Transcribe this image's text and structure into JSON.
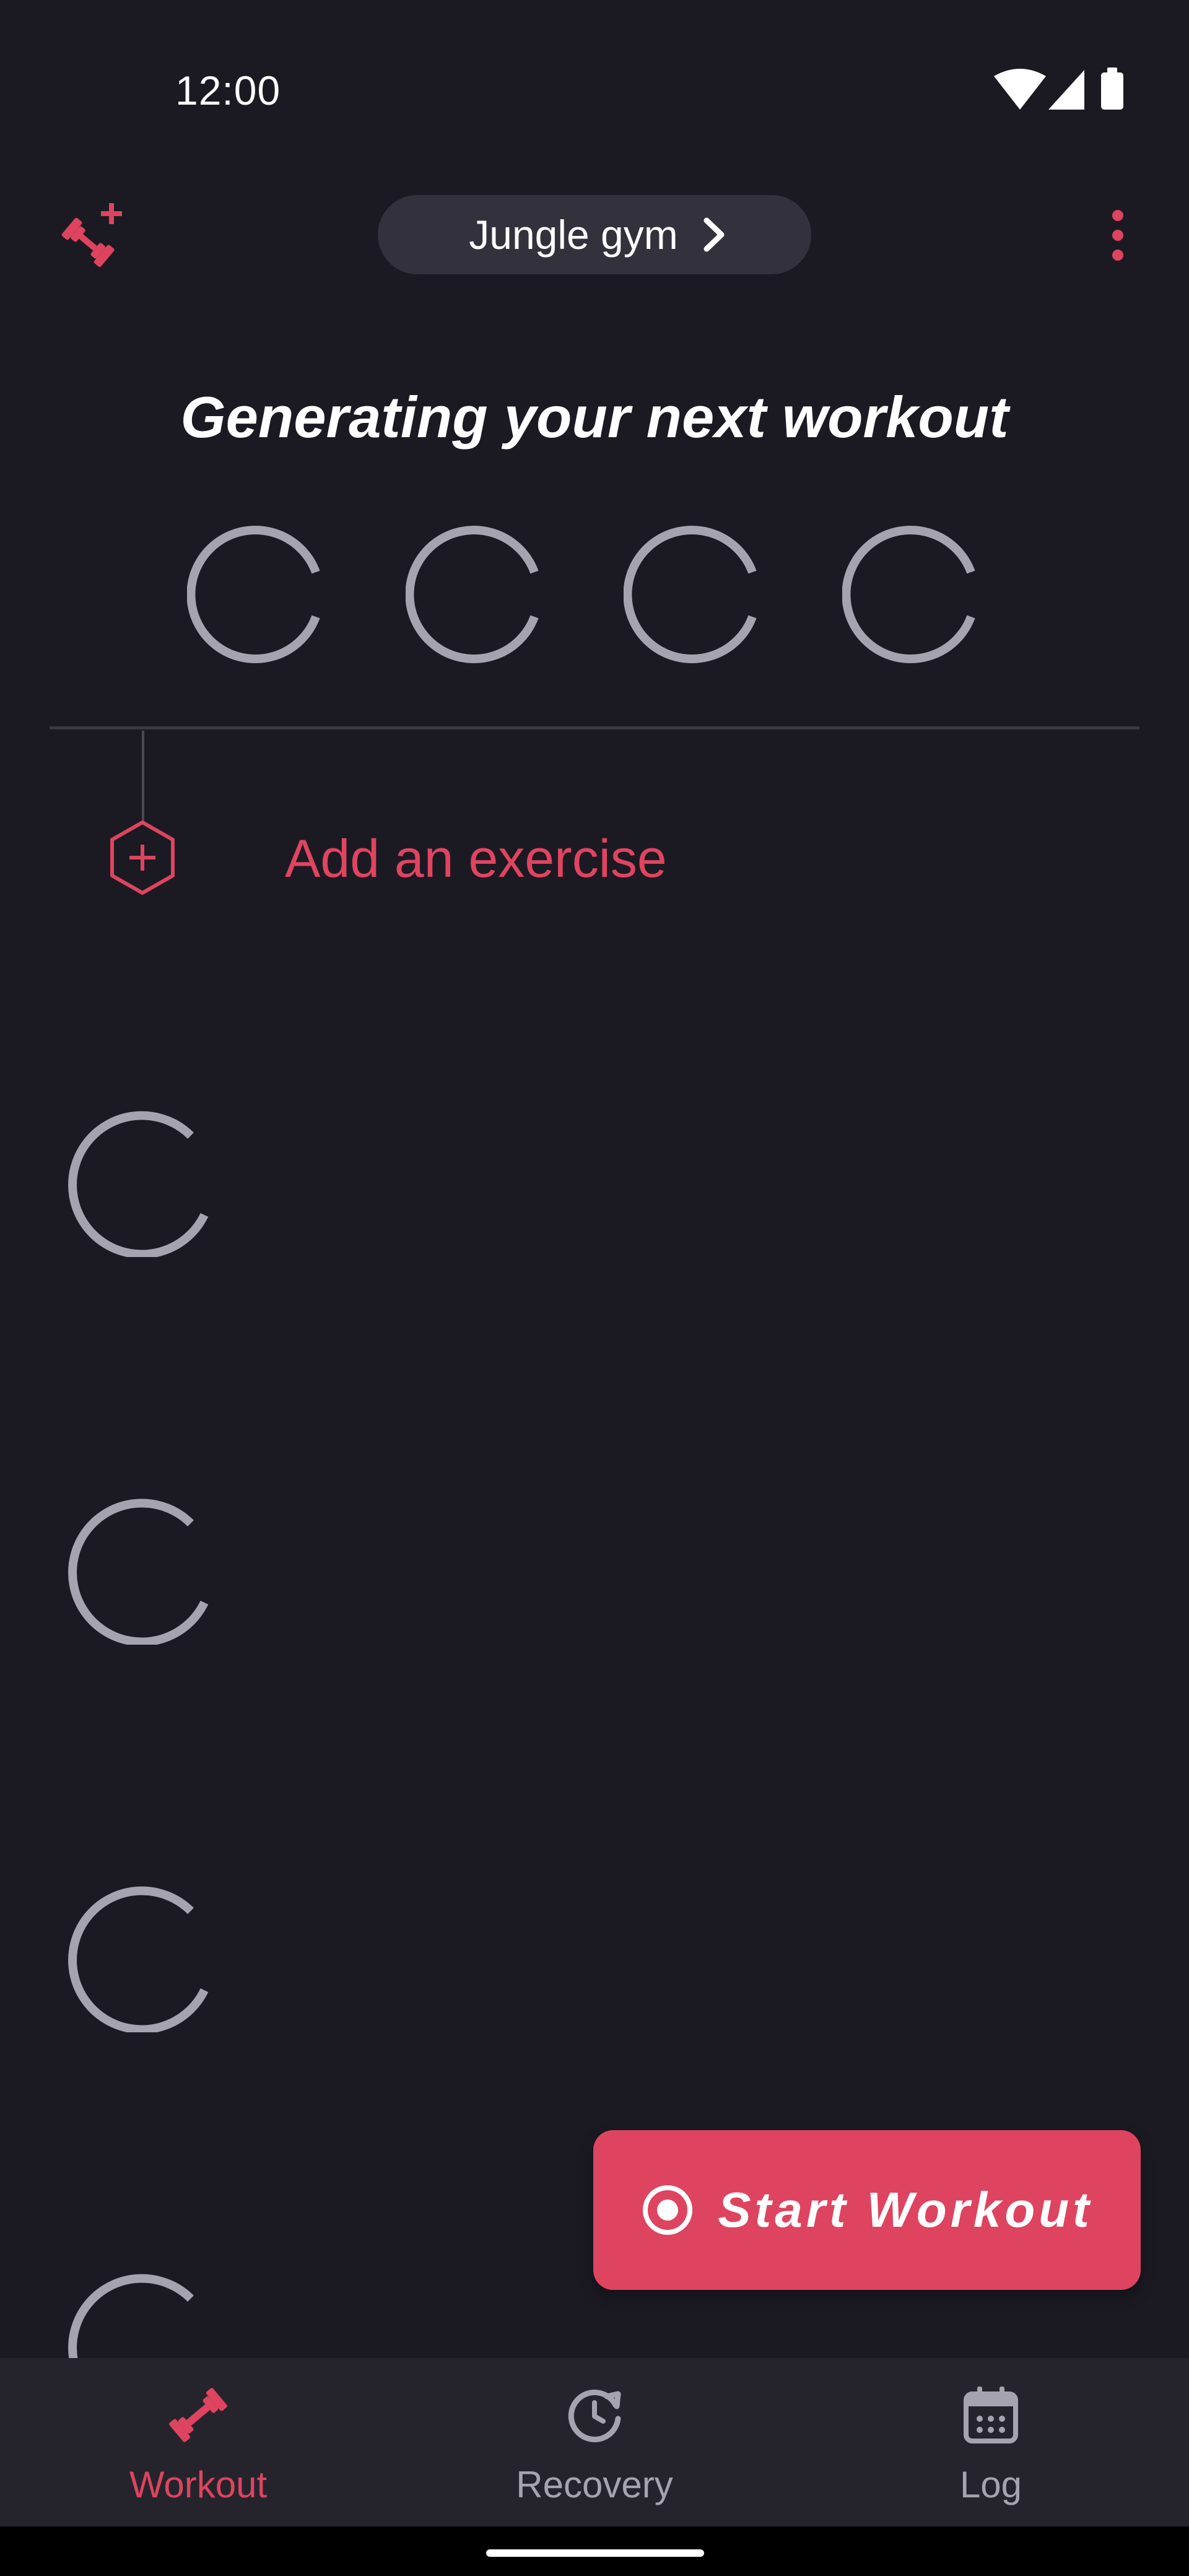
{
  "status_bar": {
    "time": "12:00",
    "icons": [
      "wifi-icon",
      "cell-signal-icon",
      "battery-icon"
    ]
  },
  "app_bar": {
    "left_icon": "add-exercise-dumbbell-icon",
    "gym_name": "Jungle gym",
    "gym_chevron": "chevron-right-icon",
    "menu_icon": "more-vert-icon"
  },
  "workout": {
    "heading": "Generating your next workout",
    "add_exercise_label": "Add an exercise"
  },
  "fab": {
    "label": "Start Workout",
    "icon": "record-icon"
  },
  "bottom_nav": {
    "items": [
      {
        "label": "Workout",
        "icon": "dumbbell-icon",
        "active": true
      },
      {
        "label": "Recovery",
        "icon": "recovery-clock-icon",
        "active": false
      },
      {
        "label": "Log",
        "icon": "calendar-icon",
        "active": false
      }
    ]
  },
  "colors": {
    "background": "#1b1a23",
    "accent": "#de445f",
    "chip_bg": "#33323c",
    "spinner": "#a5a4ae",
    "nav_bg": "#25242d"
  }
}
